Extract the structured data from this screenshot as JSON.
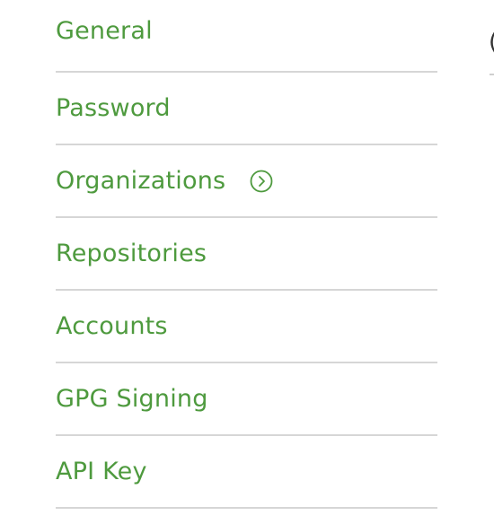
{
  "settings_nav": {
    "items": [
      {
        "label": "General"
      },
      {
        "label": "Password"
      },
      {
        "label": "Organizations",
        "icon": "chevron-right-circle-icon"
      },
      {
        "label": "Repositories"
      },
      {
        "label": "Accounts"
      },
      {
        "label": "GPG Signing"
      },
      {
        "label": "API Key"
      }
    ]
  },
  "colors": {
    "link_green": "#4e9a3e",
    "divider": "#d6d6d6"
  }
}
